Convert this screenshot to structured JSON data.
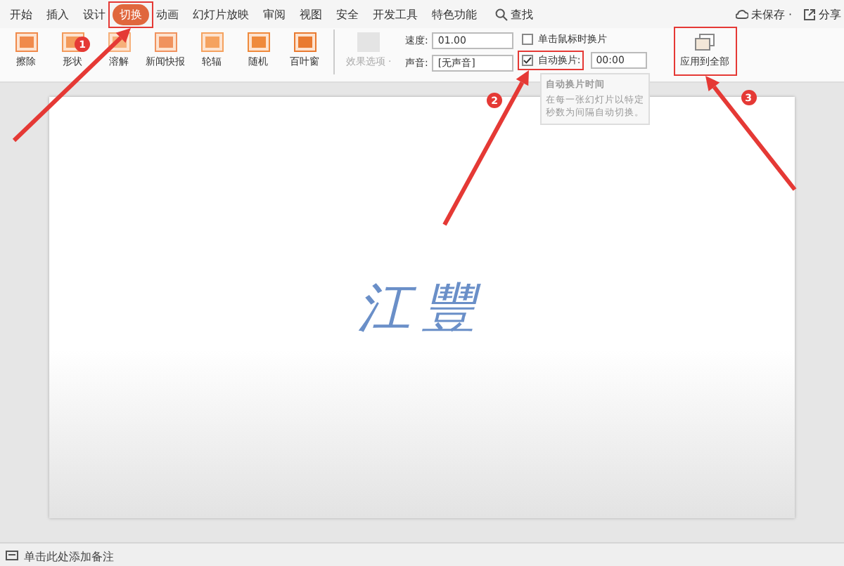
{
  "tabs": [
    {
      "label": "开始",
      "selected": false
    },
    {
      "label": "插入",
      "selected": false
    },
    {
      "label": "设计",
      "selected": false
    },
    {
      "label": "切换",
      "selected": true
    },
    {
      "label": "动画",
      "selected": false
    },
    {
      "label": "幻灯片放映",
      "selected": false
    },
    {
      "label": "审阅",
      "selected": false
    },
    {
      "label": "视图",
      "selected": false
    },
    {
      "label": "安全",
      "selected": false
    },
    {
      "label": "开发工具",
      "selected": false
    },
    {
      "label": "特色功能",
      "selected": false
    }
  ],
  "search": {
    "label": "查找"
  },
  "right_actions": [
    {
      "label": "未保存 ·"
    },
    {
      "label": "分享"
    }
  ],
  "effects": [
    {
      "label": "擦除"
    },
    {
      "label": "形状"
    },
    {
      "label": "溶解"
    },
    {
      "label": "新闻快报"
    },
    {
      "label": "轮辐"
    },
    {
      "label": "随机"
    },
    {
      "label": "百叶窗"
    }
  ],
  "effect_options": {
    "label": "效果选项 ·",
    "disabled": true
  },
  "speed": {
    "label": "速度:",
    "value": "01.00"
  },
  "sound": {
    "label": "声音:",
    "value": "[无声音]"
  },
  "on_click": {
    "label": "单击鼠标时换片",
    "checked": false
  },
  "auto_advance": {
    "label": "自动换片:",
    "checked": true,
    "value": "00:00"
  },
  "apply_all": {
    "label": "应用到全部"
  },
  "tooltip": {
    "title": "自动换片时间",
    "text": "在每一张幻灯片以特定秒数为间隔自动切换。"
  },
  "slide": {
    "title": "江豐"
  },
  "notes": {
    "placeholder": "单击此处添加备注"
  },
  "annotations": [
    {
      "number": "1"
    },
    {
      "number": "2"
    },
    {
      "number": "3"
    }
  ]
}
